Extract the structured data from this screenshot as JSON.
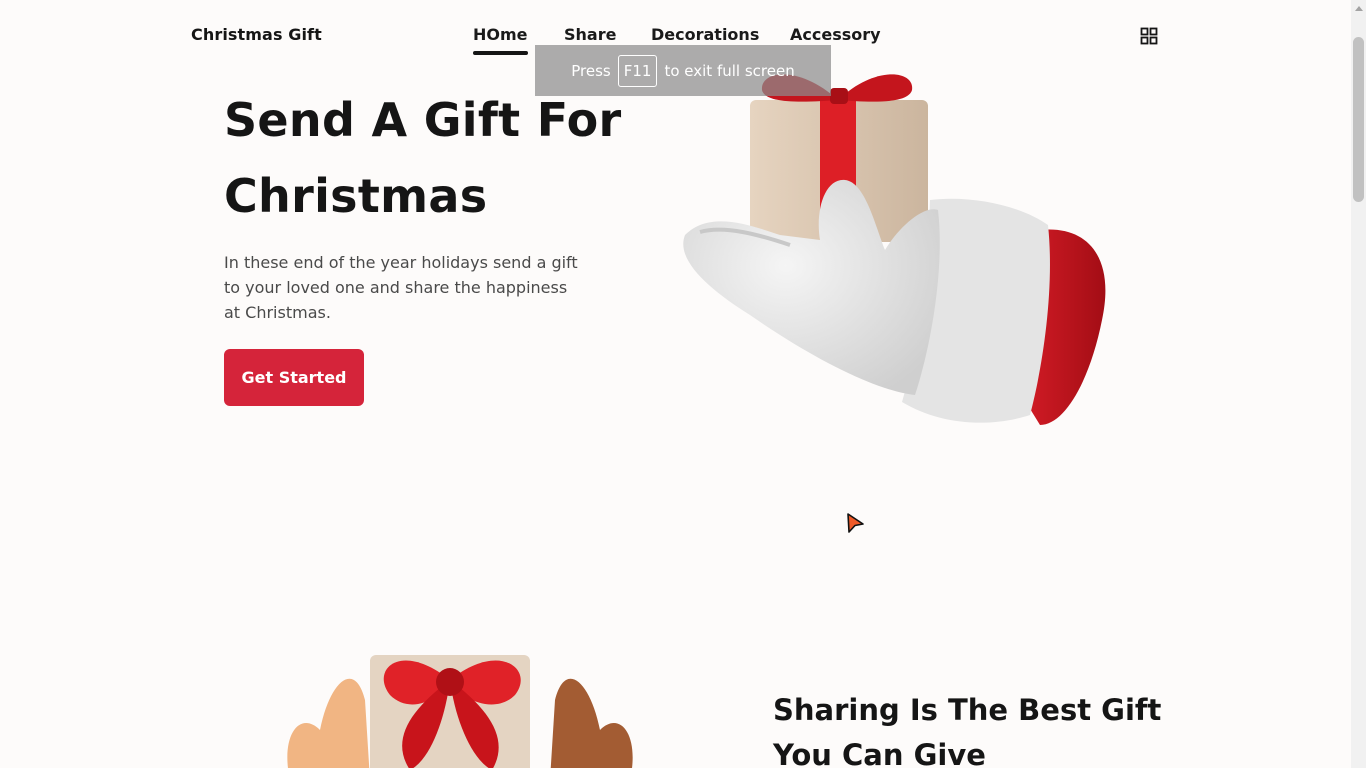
{
  "header": {
    "logo": "Christmas Gift",
    "nav": [
      {
        "label": "HOme",
        "active": true
      },
      {
        "label": "Share",
        "active": false
      },
      {
        "label": "Decorations",
        "active": false
      },
      {
        "label": "Accessory",
        "active": false
      }
    ],
    "menu_icon": "grid-icon"
  },
  "toast": {
    "press": "Press",
    "key": "F11",
    "suffix": "to exit full screen"
  },
  "hero": {
    "title_line1": "Send A Gift For",
    "title_line2": "Christmas",
    "description": "In these end of the year holidays send a gift to your loved one and share the happiness at Christmas.",
    "cta": "Get Started",
    "image": "santa-hand-gift-illustration"
  },
  "share": {
    "title_line1": "Sharing Is The Best Gift",
    "title_line2": "You Can Give",
    "image": "hands-sharing-gift-illustration"
  },
  "colors": {
    "accent": "#d5243a",
    "background": "#fdfbfa",
    "text": "#151515"
  }
}
